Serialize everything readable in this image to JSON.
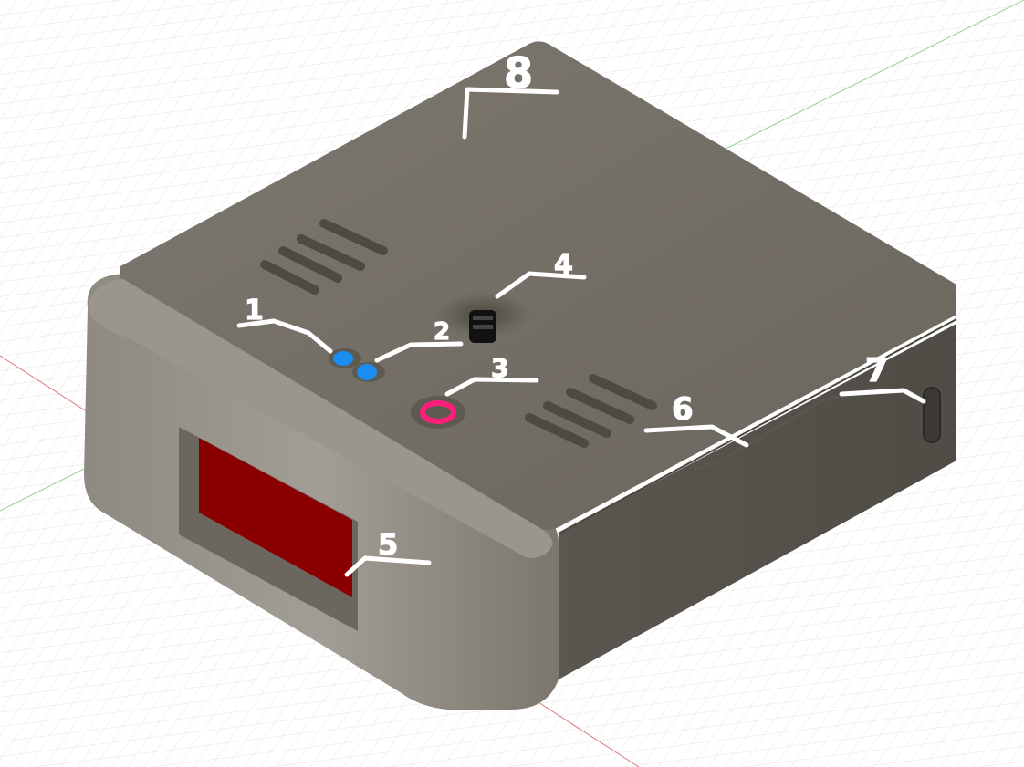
{
  "scene": {
    "background": "#ffffff",
    "grid_color": "#dcdcdc",
    "axis_red": "#e07a7a",
    "axis_green": "#7acb7a"
  },
  "enclosure": {
    "body_color": "#7a756d",
    "top_color": "#6f6a62",
    "front_color": "#8a857d"
  },
  "callouts": [
    {
      "id": "1",
      "label": "1",
      "part": "led",
      "color": "#1b8cf2"
    },
    {
      "id": "2",
      "label": "2",
      "part": "led",
      "color": "#1b8cf2"
    },
    {
      "id": "3",
      "label": "3",
      "part": "button",
      "color": "#ff1f7a"
    },
    {
      "id": "4",
      "label": "4",
      "part": "knob",
      "color": "#111111"
    },
    {
      "id": "5",
      "label": "5",
      "part": "display",
      "color": "#8a0000"
    },
    {
      "id": "6",
      "label": "6",
      "part": "seam",
      "color": "#ffffff"
    },
    {
      "id": "7",
      "label": "7",
      "part": "port",
      "color": "#ffffff"
    },
    {
      "id": "8",
      "label": "8",
      "part": "lid",
      "color": "#ffffff"
    }
  ]
}
